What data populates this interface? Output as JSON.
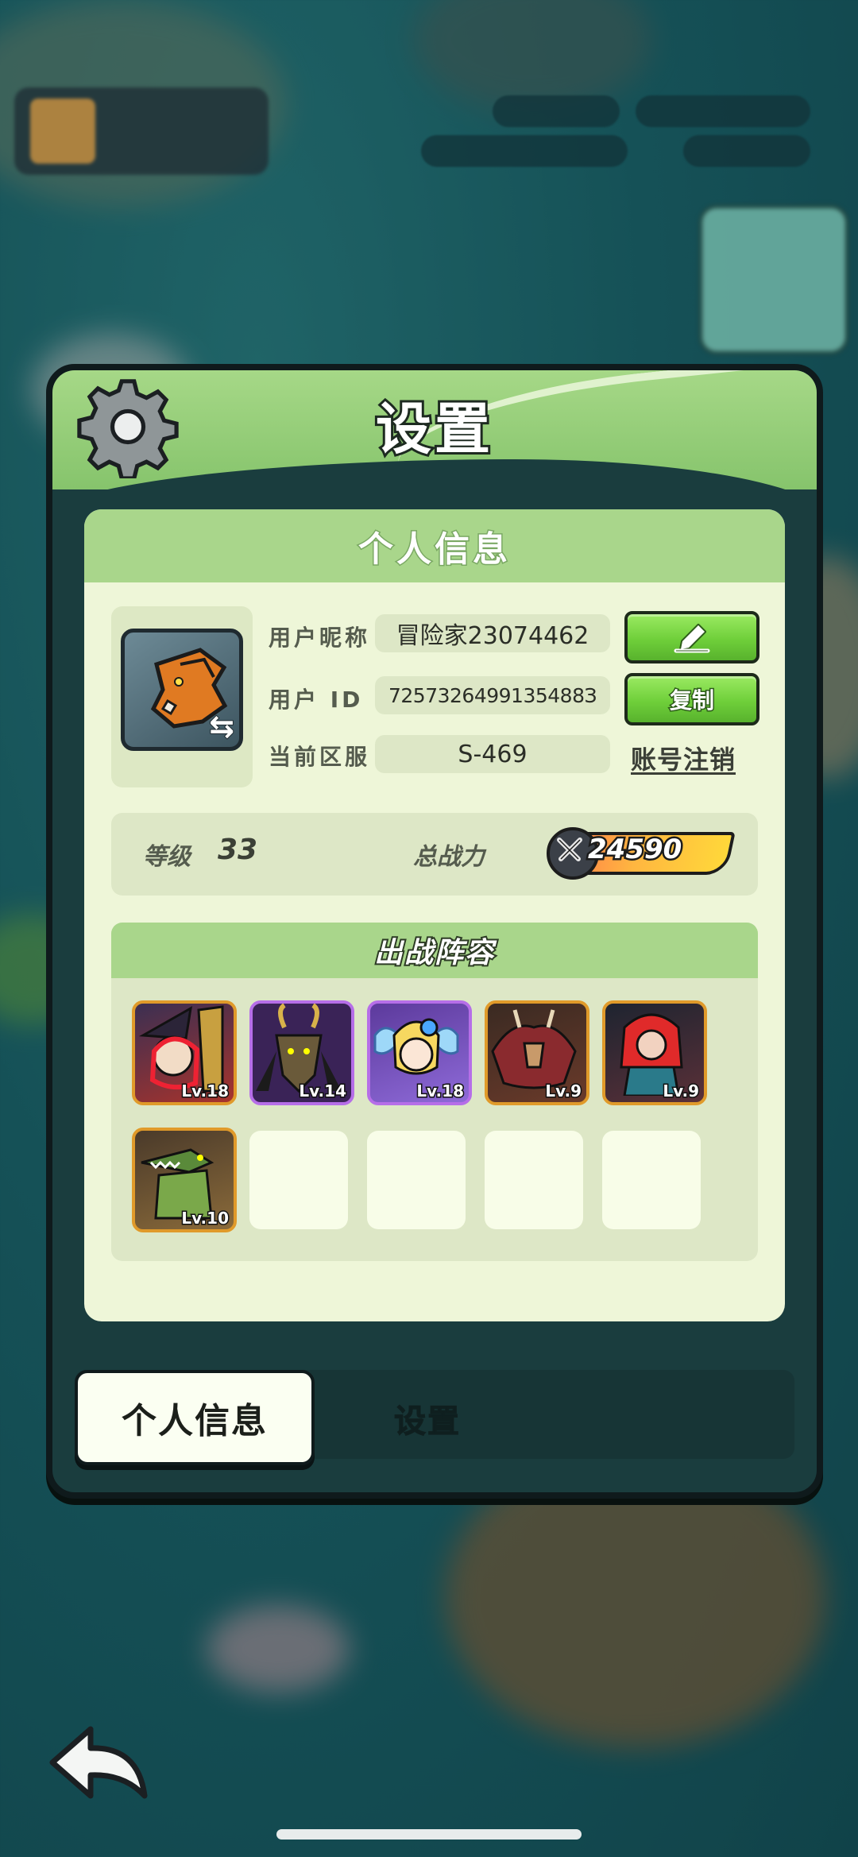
{
  "dialog": {
    "title": "设置",
    "section_title": "个人信息"
  },
  "profile": {
    "nickname_label": "用户昵称",
    "nickname": "冒险家23074462",
    "id_label": "用户 ID",
    "user_id": "7257326499135488З",
    "server_label": "当前区服",
    "server": "S-469",
    "copy_label": "复制",
    "delete_account_label": "账号注销"
  },
  "stats": {
    "level_label": "等级",
    "level": "33",
    "power_label": "总战力",
    "power": "24590"
  },
  "lineup": {
    "title": "出战阵容",
    "heroes": [
      {
        "level": "Lv.18",
        "frame": "orange"
      },
      {
        "level": "Lv.14",
        "frame": "purple"
      },
      {
        "level": "Lv.18",
        "frame": "purple"
      },
      {
        "level": "Lv.9",
        "frame": "orange"
      },
      {
        "level": "Lv.9",
        "frame": "orange"
      },
      {
        "level": "Lv.10",
        "frame": "orange"
      }
    ],
    "empty_slots": 4
  },
  "tabs": {
    "active": "个人信息",
    "other": "设置"
  },
  "colors": {
    "header_green": "#a6d887",
    "button_green": "#6fcf3a",
    "card_bg": "#eef6d8",
    "rare_purple": "#b66ee8",
    "epic_orange": "#e09a2a"
  }
}
